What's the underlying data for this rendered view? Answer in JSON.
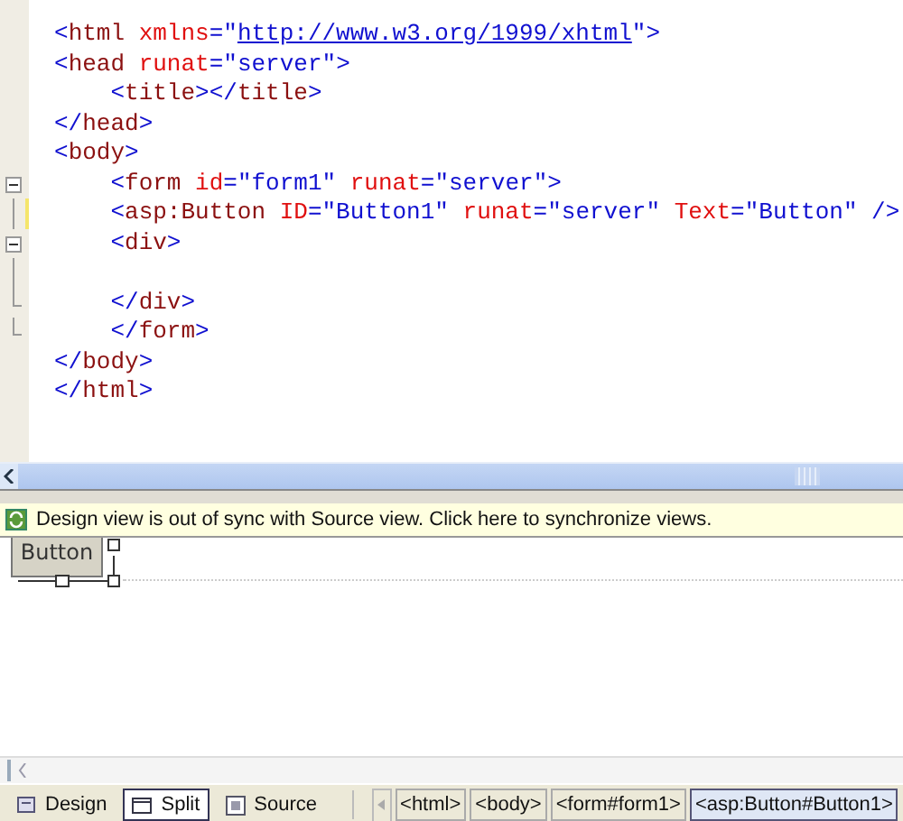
{
  "source_editor": {
    "lines": [
      {
        "tokens": [
          {
            "kind": "punct",
            "text": "<"
          },
          {
            "kind": "tag",
            "text": "html"
          },
          {
            "kind": "attr",
            "text": " xmlns"
          },
          {
            "kind": "punct",
            "text": "=\""
          },
          {
            "kind": "link",
            "text": "http://www.w3.org/1999/xhtml"
          },
          {
            "kind": "punct",
            "text": "\">"
          }
        ]
      },
      {
        "tokens": [
          {
            "kind": "punct",
            "text": "<"
          },
          {
            "kind": "tag",
            "text": "head"
          },
          {
            "kind": "attr",
            "text": " runat"
          },
          {
            "kind": "punct",
            "text": "=\""
          },
          {
            "kind": "value",
            "text": "server"
          },
          {
            "kind": "punct",
            "text": "\">"
          }
        ],
        "children": [
          {
            "tokens": [
              {
                "kind": "punct",
                "text": "<"
              },
              {
                "kind": "tag",
                "text": "title"
              },
              {
                "kind": "punct",
                "text": "></"
              },
              {
                "kind": "tag",
                "text": "title"
              },
              {
                "kind": "punct",
                "text": ">"
              }
            ]
          }
        ]
      },
      {
        "tokens": [
          {
            "kind": "punct",
            "text": "</"
          },
          {
            "kind": "tag",
            "text": "head"
          },
          {
            "kind": "punct",
            "text": ">"
          }
        ]
      },
      {
        "tokens": [
          {
            "kind": "punct",
            "text": "<"
          },
          {
            "kind": "tag",
            "text": "body"
          },
          {
            "kind": "punct",
            "text": ">"
          }
        ],
        "children": [
          {
            "kind": "collapse",
            "tokens": [
              {
                "kind": "punct",
                "text": "<"
              },
              {
                "kind": "tag",
                "text": "form"
              },
              {
                "kind": "attr",
                "text": " id"
              },
              {
                "kind": "punct",
                "text": "=\""
              },
              {
                "kind": "value",
                "text": "form1"
              },
              {
                "kind": "punct",
                "text": "\""
              },
              {
                "kind": "attr",
                "text": " runat"
              },
              {
                "kind": "punct",
                "text": "=\""
              },
              {
                "kind": "value",
                "text": "server"
              },
              {
                "kind": "punct",
                "text": "\">"
              }
            ]
          },
          {
            "kind": "guide",
            "modified": true,
            "tokens": [
              {
                "kind": "punct",
                "text": "<"
              },
              {
                "kind": "tag",
                "text": "asp:Button"
              },
              {
                "kind": "attr",
                "text": " ID"
              },
              {
                "kind": "punct",
                "text": "=\""
              },
              {
                "kind": "value",
                "text": "Button1"
              },
              {
                "kind": "punct",
                "text": "\""
              },
              {
                "kind": "attr",
                "text": " runat"
              },
              {
                "kind": "punct",
                "text": "=\""
              },
              {
                "kind": "value",
                "text": "server"
              },
              {
                "kind": "punct",
                "text": "\""
              },
              {
                "kind": "attr",
                "text": " Text"
              },
              {
                "kind": "punct",
                "text": "=\""
              },
              {
                "kind": "value",
                "text": "Button"
              },
              {
                "kind": "punct",
                "text": "\" />"
              }
            ]
          },
          {
            "kind": "collapse",
            "tokens": [
              {
                "kind": "punct",
                "text": "<"
              },
              {
                "kind": "tag",
                "text": "div"
              },
              {
                "kind": "punct",
                "text": ">"
              }
            ]
          },
          {
            "kind": "guide"
          },
          {
            "kind": "end",
            "tokens": [
              {
                "kind": "punct",
                "text": "</"
              },
              {
                "kind": "tag",
                "text": "div"
              },
              {
                "kind": "punct",
                "text": ">"
              }
            ]
          },
          {
            "kind": "end",
            "tokens": [
              {
                "kind": "punct",
                "text": "</"
              },
              {
                "kind": "tag",
                "text": "form"
              },
              {
                "kind": "punct",
                "text": ">"
              }
            ]
          }
        ]
      },
      {
        "tokens": [
          {
            "kind": "punct",
            "text": "</"
          },
          {
            "kind": "tag",
            "text": "body"
          },
          {
            "kind": "punct",
            "text": ">"
          }
        ]
      },
      {
        "tokens": [
          {
            "kind": "punct",
            "text": "</"
          },
          {
            "kind": "tag",
            "text": "html"
          },
          {
            "kind": "punct",
            "text": ">"
          }
        ]
      }
    ]
  },
  "sync_bar": {
    "message": "Design view is out of sync with Source view. Click here to synchronize views."
  },
  "design_view": {
    "button": {
      "label": "Button"
    }
  },
  "view_tabs": [
    {
      "label": "Design",
      "selected": false
    },
    {
      "label": "Split",
      "selected": true
    },
    {
      "label": "Source",
      "selected": false
    }
  ],
  "breadcrumbs": [
    {
      "label": "<html>",
      "selected": false
    },
    {
      "label": "<body>",
      "selected": false
    },
    {
      "label": "<form#form1>",
      "selected": false
    },
    {
      "label": "<asp:Button#Button1>",
      "selected": true
    }
  ]
}
